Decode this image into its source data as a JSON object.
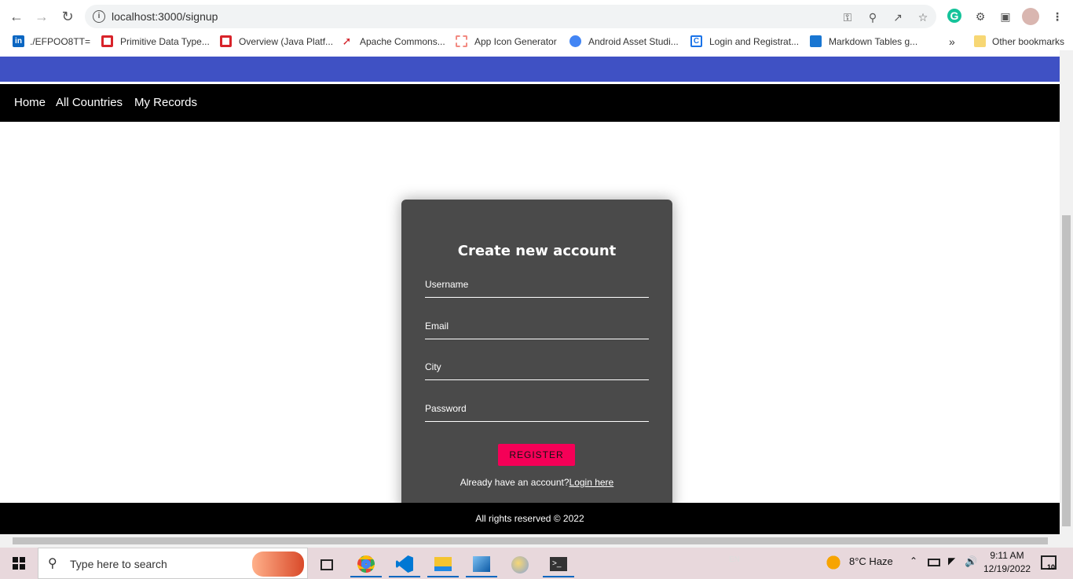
{
  "browser": {
    "url": "localhost:3000/signup",
    "bookmarks": [
      {
        "label": "./EFPOO8TT=",
        "color": "#0a66c2"
      },
      {
        "label": "Primitive Data Type...",
        "color": "#d8232a"
      },
      {
        "label": "Overview (Java Platf...",
        "color": "#d8232a"
      },
      {
        "label": "Apache Commons...",
        "color": "#d22128"
      },
      {
        "label": "App Icon Generator",
        "color": "#f28b82"
      },
      {
        "label": "Android Asset Studi...",
        "color": "#4285f4"
      },
      {
        "label": "Login and Registrat...",
        "color": "#1a73e8"
      },
      {
        "label": "Markdown Tables g...",
        "color": "#1976d2"
      }
    ],
    "more_label": "»",
    "other_bookmarks": "Other bookmarks"
  },
  "nav": {
    "home": "Home",
    "all_countries": "All Countries",
    "my_records": "My Records"
  },
  "form": {
    "title": "Create new account",
    "username": "Username",
    "email": "Email",
    "city": "City",
    "password": "Password",
    "register": "REGISTER",
    "already": "Already have an account?",
    "login_link": "Login here"
  },
  "footer": {
    "text": "All rights reserved © 2022"
  },
  "taskbar": {
    "search_placeholder": "Type here to search",
    "weather": "8°C  Haze",
    "time": "9:11 AM",
    "date": "12/19/2022",
    "notifications": "10"
  },
  "colors": {
    "accent_bar": "#3f51c4",
    "register_button": "#f50057",
    "card": "#4a4a4a"
  }
}
